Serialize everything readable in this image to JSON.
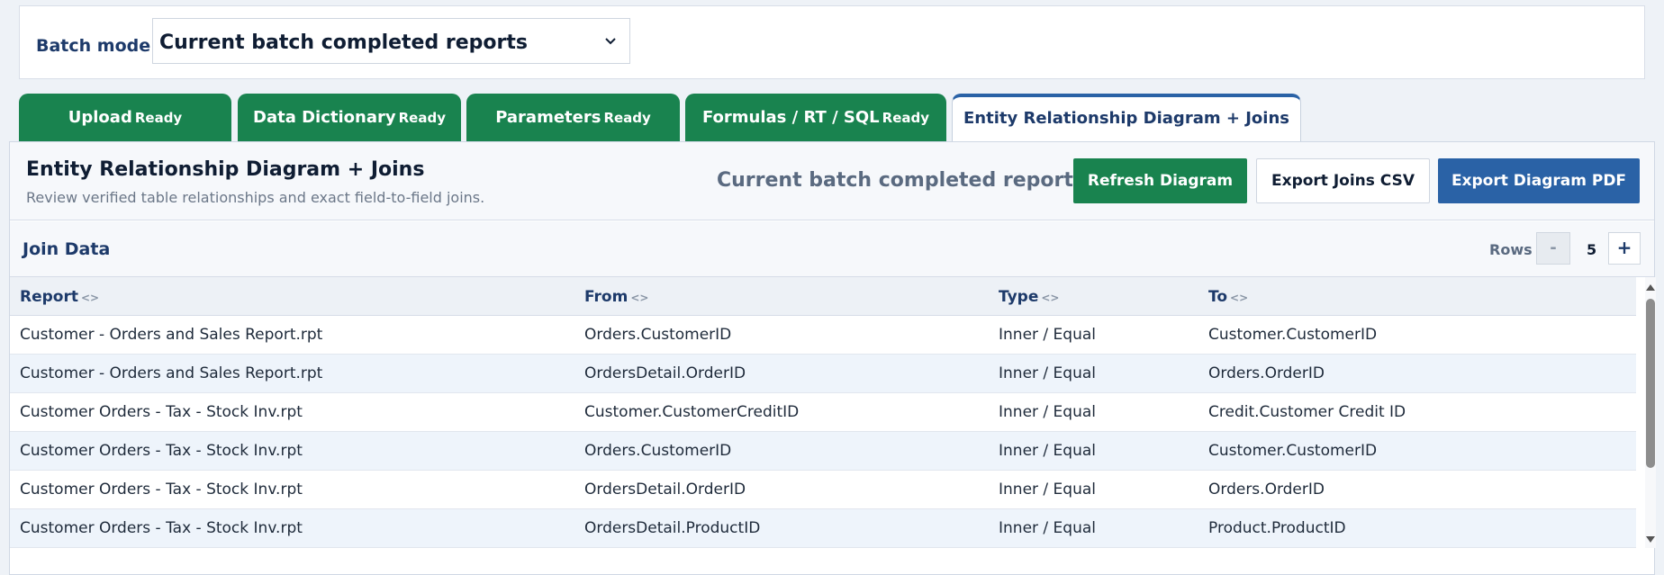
{
  "batch": {
    "label": "Batch mode",
    "selected": "Current batch completed reports"
  },
  "tabs": [
    {
      "label": "Upload",
      "status": "Ready"
    },
    {
      "label": "Data Dictionary",
      "status": "Ready"
    },
    {
      "label": "Parameters",
      "status": "Ready"
    },
    {
      "label": "Formulas / RT / SQL",
      "status": "Ready"
    },
    {
      "label": "Entity Relationship Diagram + Joins",
      "status": ""
    }
  ],
  "panel": {
    "title": "Entity Relationship Diagram + Joins",
    "subtitle": "Review verified table relationships and exact field-to-field joins.",
    "batch_name": "Current batch completed reports",
    "refresh_label": "Refresh Diagram",
    "export_csv_label": "Export Joins CSV",
    "export_pdf_label": "Export Diagram PDF"
  },
  "join_data": {
    "title": "Join Data",
    "rows_label": "Rows",
    "rows_minus": "-",
    "rows_value": "5",
    "rows_plus": "+",
    "sort_glyph": "<>",
    "columns": [
      "Report",
      "From",
      "Type",
      "To"
    ],
    "rows": [
      [
        "Customer - Orders and Sales Report.rpt",
        "Orders.CustomerID",
        "Inner / Equal",
        "Customer.CustomerID"
      ],
      [
        "Customer - Orders and Sales Report.rpt",
        "OrdersDetail.OrderID",
        "Inner / Equal",
        "Orders.OrderID"
      ],
      [
        "Customer Orders - Tax - Stock Inv.rpt",
        "Customer.CustomerCreditID",
        "Inner / Equal",
        "Credit.Customer Credit ID"
      ],
      [
        "Customer Orders - Tax - Stock Inv.rpt",
        "Orders.CustomerID",
        "Inner / Equal",
        "Customer.CustomerID"
      ],
      [
        "Customer Orders - Tax - Stock Inv.rpt",
        "OrdersDetail.OrderID",
        "Inner / Equal",
        "Orders.OrderID"
      ],
      [
        "Customer Orders - Tax - Stock Inv.rpt",
        "OrdersDetail.ProductID",
        "Inner / Equal",
        "Product.ProductID"
      ]
    ]
  },
  "icons": {
    "select": "chevron-down-icon",
    "scroll_up": "arrow-up-icon",
    "scroll_down": "arrow-down-icon"
  },
  "colors": {
    "tab_green": "#19834f",
    "primary_blue": "#2a62a6",
    "title_navy": "#1d3a6a"
  }
}
